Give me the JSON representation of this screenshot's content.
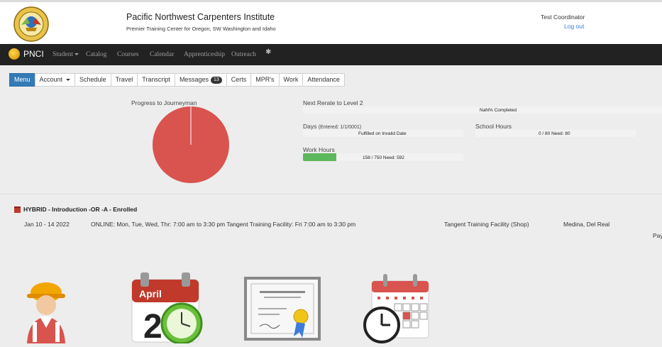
{
  "header": {
    "title": "Pacific Northwest Carpenters Institute",
    "subtitle": "Premier Training Center for Oregon, SW Washington and Idaho",
    "user": "Test Coordinator",
    "logout": "Log out"
  },
  "navbar": {
    "brand": "PNCI",
    "items": [
      "Student",
      "Catalog",
      "Courses",
      "Calendar",
      "Apprenticeship",
      "Outreach"
    ]
  },
  "tabs": [
    "Menu",
    "Account",
    "Schedule",
    "Travel",
    "Transcript",
    "Messages",
    "Certs",
    "MPR's",
    "Work",
    "Attendance"
  ],
  "messages_badge": "13",
  "progress": {
    "pie_label": "Progress to Journeyman",
    "next_rerate_label": "Next Rerate to Level 2",
    "next_rerate_text": "NaN% Completed",
    "days_label": "Days",
    "days_entered": "(Entered: 1/1/0001)",
    "days_text": "Fulfilled on Invalid Date",
    "school_hours_label": "School Hours",
    "school_hours_text": "0 / 80 Need: 80",
    "work_hours_label": "Work Hours",
    "work_hours_text": "158 / 750 Need: 592",
    "work_hours_fraction": 0.21
  },
  "course": {
    "title": "HYBRID - Introduction -OR -A - Enrolled",
    "dates": "Jan 10 - 14 2022",
    "schedule": "ONLINE: Mon, Tue, Wed, Thr: 7:00 am to 3:30 pm Tangent Training Facility: Fri 7:00 am to 3:30 pm",
    "location": "Tangent Training Facility (Shop)",
    "instructors": "Medina, Del Real",
    "pay": "Pay"
  },
  "tiles": {
    "calendar_month": "April",
    "calendar_day": "2"
  },
  "colors": {
    "pie": "#d9534f",
    "work_bar": "#5cb85c",
    "active_tab": "#337ab7",
    "navbar": "#222222"
  }
}
